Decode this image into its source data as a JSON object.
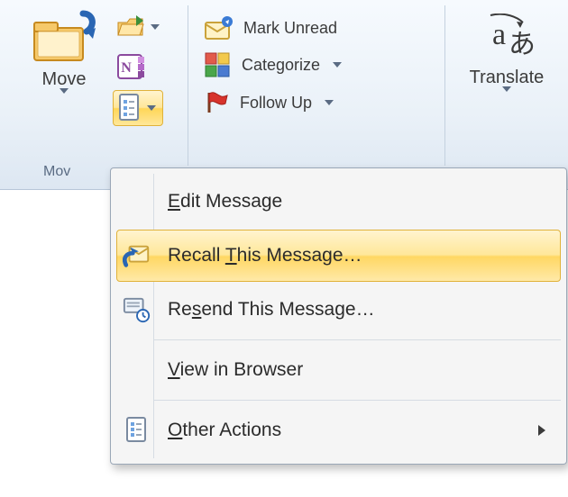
{
  "ribbon": {
    "move_group": {
      "move_button": "Move",
      "label": "Mov"
    },
    "tags_group": {
      "mark_unread": "Mark Unread",
      "categorize": "Categorize",
      "follow_up": "Follow Up"
    },
    "translate_group": {
      "translate": "Translate"
    }
  },
  "menu": {
    "edit_message": "Edit Message",
    "recall": "Recall This Message…",
    "resend": "Resend This Message…",
    "view_browser": "View in Browser",
    "other_actions": "Other Actions"
  }
}
